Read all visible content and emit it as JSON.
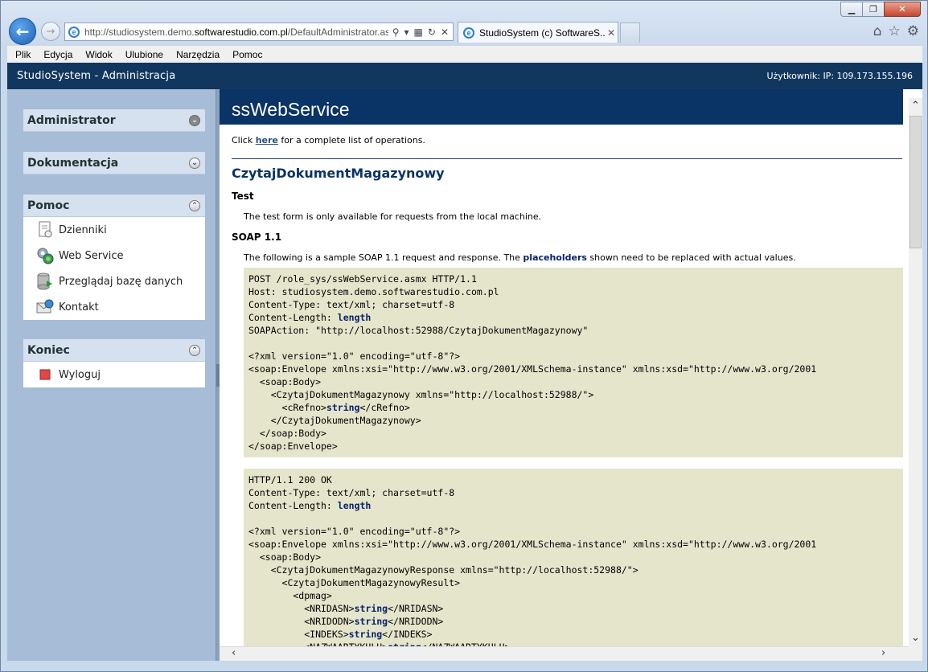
{
  "browser": {
    "url_prefix": "http://studiosystem.demo.",
    "url_domain": "softwarestudio.com.pl",
    "url_path": "/DefaultAdministrator.as",
    "tab_title": "StudioSystem (c) SoftwareS...",
    "tab_close": "✕",
    "menu": [
      "Plik",
      "Edycja",
      "Widok",
      "Ulubione",
      "Narzędzia",
      "Pomoc"
    ]
  },
  "app": {
    "title": "StudioSystem - Administracja",
    "user": "Użytkownik: IP: 109.173.155.196"
  },
  "sidebar": {
    "administrator": "Administrator",
    "dokumentacja": "Dokumentacja",
    "pomoc": "Pomoc",
    "pomoc_items": [
      "Dzienniki",
      "Web Service",
      "Przeglądaj bazę danych",
      "Kontakt"
    ],
    "koniec": "Koniec",
    "koniec_items": [
      "Wyloguj"
    ]
  },
  "content": {
    "title": "ssWebService",
    "intro_before": "Click ",
    "intro_link": "here",
    "intro_after": " for a complete list of operations.",
    "operation": "CzytajDokumentMagazynowy",
    "test_heading": "Test",
    "test_text": "The test form is only available for requests from the local machine.",
    "soap_heading": "SOAP 1.1",
    "soap_text_before": "The following is a sample SOAP 1.1 request and response. The ",
    "soap_text_bold": "placeholders",
    "soap_text_after": " shown need to be replaced with actual values.",
    "request": {
      "line1": "POST /role_sys/ssWebService.asmx HTTP/1.1",
      "line2": "Host: studiosystem.demo.softwarestudio.com.pl",
      "line3": "Content-Type: text/xml; charset=utf-8",
      "line4_prefix": "Content-Length: ",
      "length": "length",
      "line5": "SOAPAction: \"http://localhost:52988/CzytajDokumentMagazynowy\"",
      "xml_decl": "<?xml version=\"1.0\" encoding=\"utf-8\"?>",
      "envelope": "<soap:Envelope xmlns:xsi=\"http://www.w3.org/2001/XMLSchema-instance\" xmlns:xsd=\"http://www.w3.org/2001",
      "body_open": "  <soap:Body>",
      "op_open": "    <CzytajDokumentMagazynowy xmlns=\"http://localhost:52988/\">",
      "cref_open": "      <cRefno>",
      "string": "string",
      "cref_close": "</cRefno>",
      "op_close": "    </CzytajDokumentMagazynowy>",
      "body_close": "  </soap:Body>",
      "env_close": "</soap:Envelope>"
    },
    "response": {
      "line1": "HTTP/1.1 200 OK",
      "line2": "Content-Type: text/xml; charset=utf-8",
      "line3_prefix": "Content-Length: ",
      "resp_open": "    <CzytajDokumentMagazynowyResponse xmlns=\"http://localhost:52988/\">",
      "result_open": "      <CzytajDokumentMagazynowyResult>",
      "dpmag_open": "        <dpmag>",
      "f1_open": "          <NRIDASN>",
      "f1_close": "</NRIDASN>",
      "f2_open": "          <NRIDODN>",
      "f2_close": "</NRIDODN>",
      "f3_open": "          <INDEKS>",
      "f3_close": "</INDEKS>",
      "f4_open": "          <NAZWAARTYKULU>",
      "f4_close": "</NAZWAARTYKULU>"
    }
  }
}
